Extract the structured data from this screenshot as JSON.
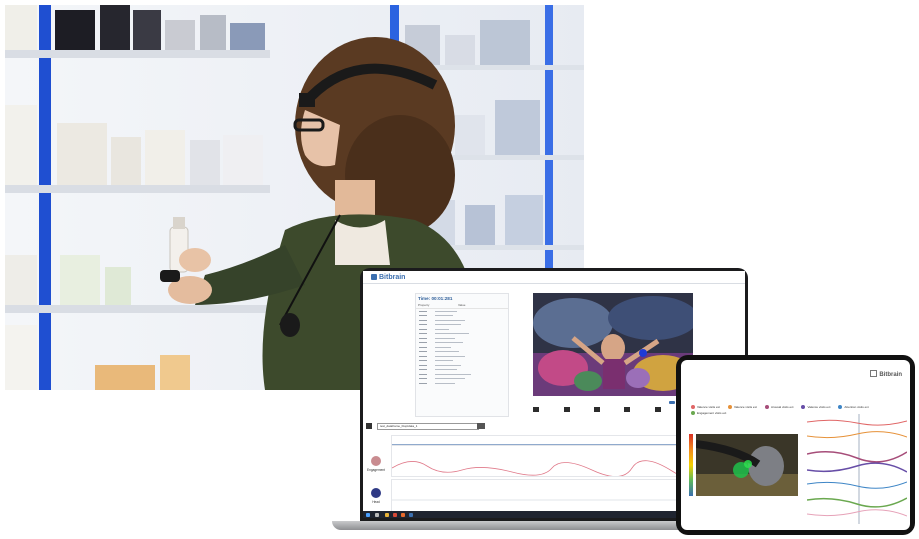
{
  "laptop_app": {
    "brand": "Bitbrain",
    "panel_title": "Time: 00:01:281",
    "panel_header_left": "Property",
    "panel_header_right": "Value",
    "select_label": "test_dataframe_bloptdata_1",
    "timeline_signals": [
      {
        "label": "Engagement",
        "color": "#c98c90"
      },
      {
        "label": "Head",
        "color": "#2f3a85"
      }
    ]
  },
  "tablet_app": {
    "brand": "Bitbrain",
    "legend": [
      {
        "label": "Valence visits ext",
        "color": "#e06666"
      },
      {
        "label": "Valence visits ext",
        "color": "#e69138"
      },
      {
        "label": "Arousal visits ext",
        "color": "#a64d79"
      },
      {
        "label": "Valence visits ext",
        "color": "#674ea7"
      },
      {
        "label": "Attention visits ext",
        "color": "#3d85c6"
      },
      {
        "label": "Engagement visits ext",
        "color": "#6aa84f"
      }
    ]
  }
}
